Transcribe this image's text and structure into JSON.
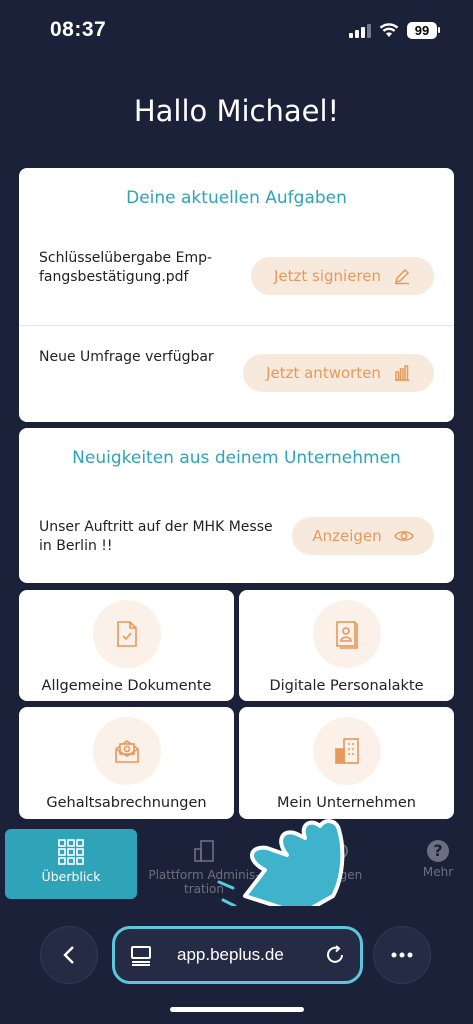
{
  "status": {
    "time": "08:37",
    "battery": "99"
  },
  "greeting": "Hallo Michael!",
  "tasks": {
    "title": "Deine aktuellen Aufgaben",
    "items": [
      {
        "text_line1": "Schlüsselübergabe Emp-",
        "text_line2": "fangsbestätigung.pdf",
        "action": "Jetzt signieren",
        "icon": "pencil-icon"
      },
      {
        "text_line1": "Neue Umfrage verfügbar",
        "text_line2": "",
        "action": "Jetzt antworten",
        "icon": "bar-chart-icon"
      }
    ]
  },
  "news": {
    "title": "Neuigkeiten aus deinem Unternehmen",
    "text_line1": "Unser Auftritt auf der MHK Messe",
    "text_line2": "in Berlin !!",
    "action": "Anzeigen",
    "icon": "eye-icon"
  },
  "tiles": [
    {
      "label": "Allgemeine Dokumente",
      "icon": "document-check-icon"
    },
    {
      "label": "Digitale Personalakte",
      "icon": "personnel-file-icon"
    },
    {
      "label": "Gehaltsabrechnungen",
      "icon": "payslip-envelope-icon"
    },
    {
      "label": "Mein Unternehmen",
      "icon": "building-icon"
    }
  ],
  "nav": {
    "overview": "Überblick",
    "platform_line1": "Plattform Adminis-",
    "platform_line2": "tration",
    "settings": "llungen",
    "more": "Mehr"
  },
  "browser": {
    "url": "app.beplus.de"
  },
  "colors": {
    "background": "#1b2138",
    "accent": "#2fa3b7",
    "action": "#e6995c",
    "action_bg": "#f8e9dd"
  }
}
